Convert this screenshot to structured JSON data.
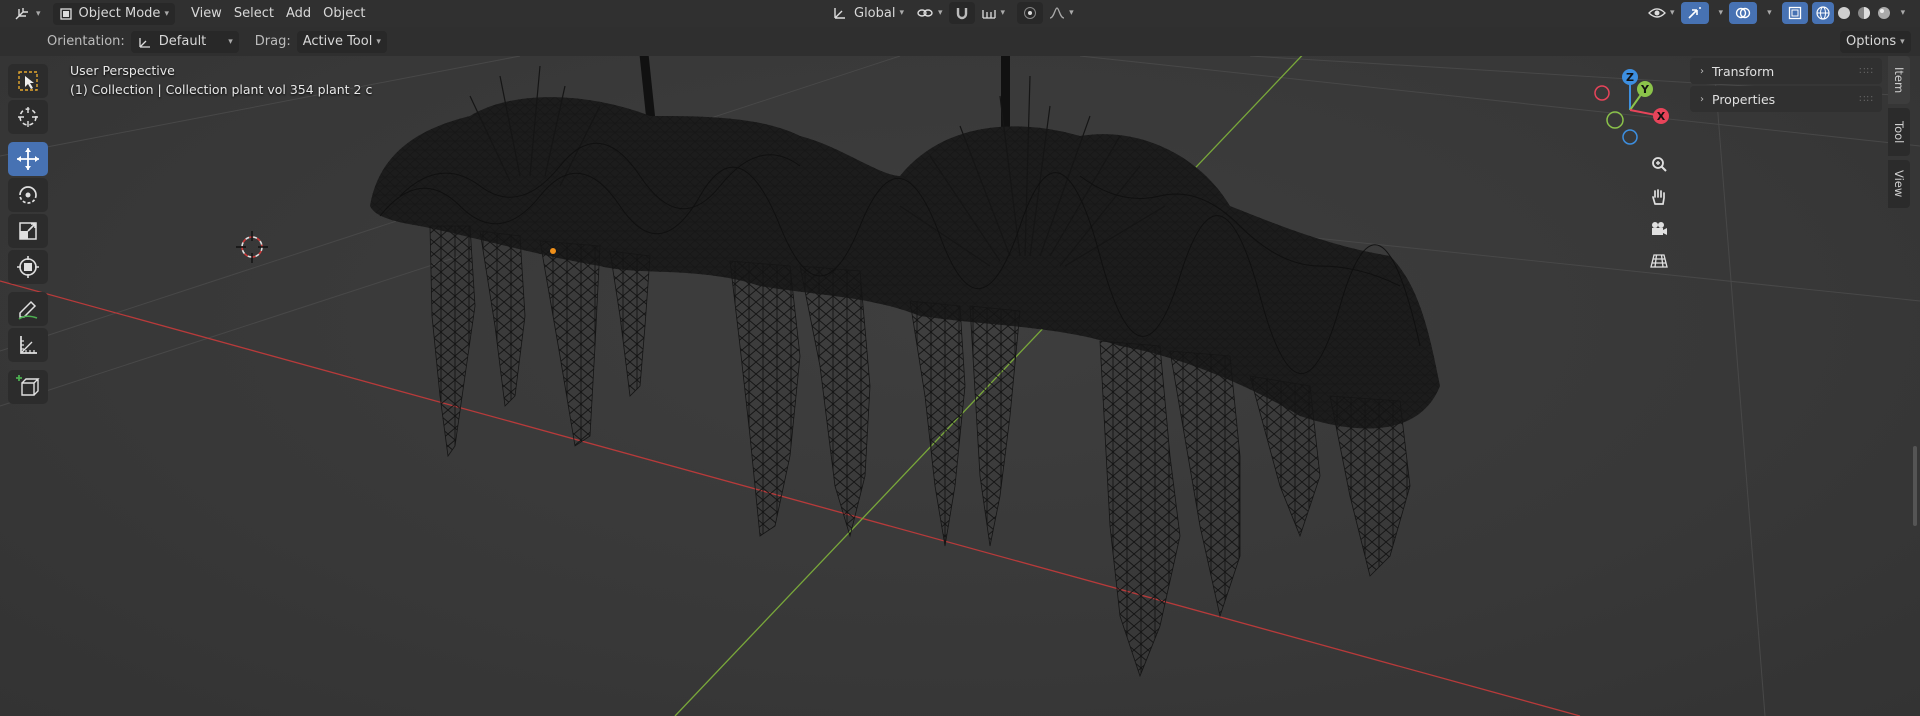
{
  "header": {
    "editor_type_icon": "editor-type-icon",
    "mode": "Object Mode",
    "menus": [
      "View",
      "Select",
      "Add",
      "Object"
    ],
    "transform_orientation": "Global",
    "snap_icon": "magnet-icon",
    "proportional_icon": "proportional-editing-icon"
  },
  "subheader": {
    "orientation_label": "Orientation:",
    "orientation_value": "Default",
    "drag_label": "Drag:",
    "drag_value": "Active Tool",
    "options_label": "Options"
  },
  "viewport": {
    "perspective_label": "User Perspective",
    "collection_label": "(1) Collection | Collection plant vol 354 plant 2 c"
  },
  "toolbar": {
    "tools": [
      "select-box",
      "cursor",
      "move",
      "rotate",
      "scale",
      "transform",
      "annotate",
      "measure",
      "add-cube"
    ],
    "active_tool": "move"
  },
  "sidebar": {
    "panels": [
      "Transform",
      "Properties"
    ],
    "tabs": [
      "Item",
      "Tool",
      "View"
    ],
    "active_tab": "Item"
  },
  "gizmo": {
    "axes": [
      "X",
      "Y",
      "Z"
    ],
    "colors": {
      "x": "#e8445a",
      "y": "#8bc34a",
      "z": "#3d8fe0"
    }
  },
  "colors": {
    "accent": "#4772b3",
    "header_bg": "#303030",
    "viewport_bg": "#393939",
    "x_axis_line": "#c23b3b",
    "y_axis_line": "#7fb33a"
  }
}
